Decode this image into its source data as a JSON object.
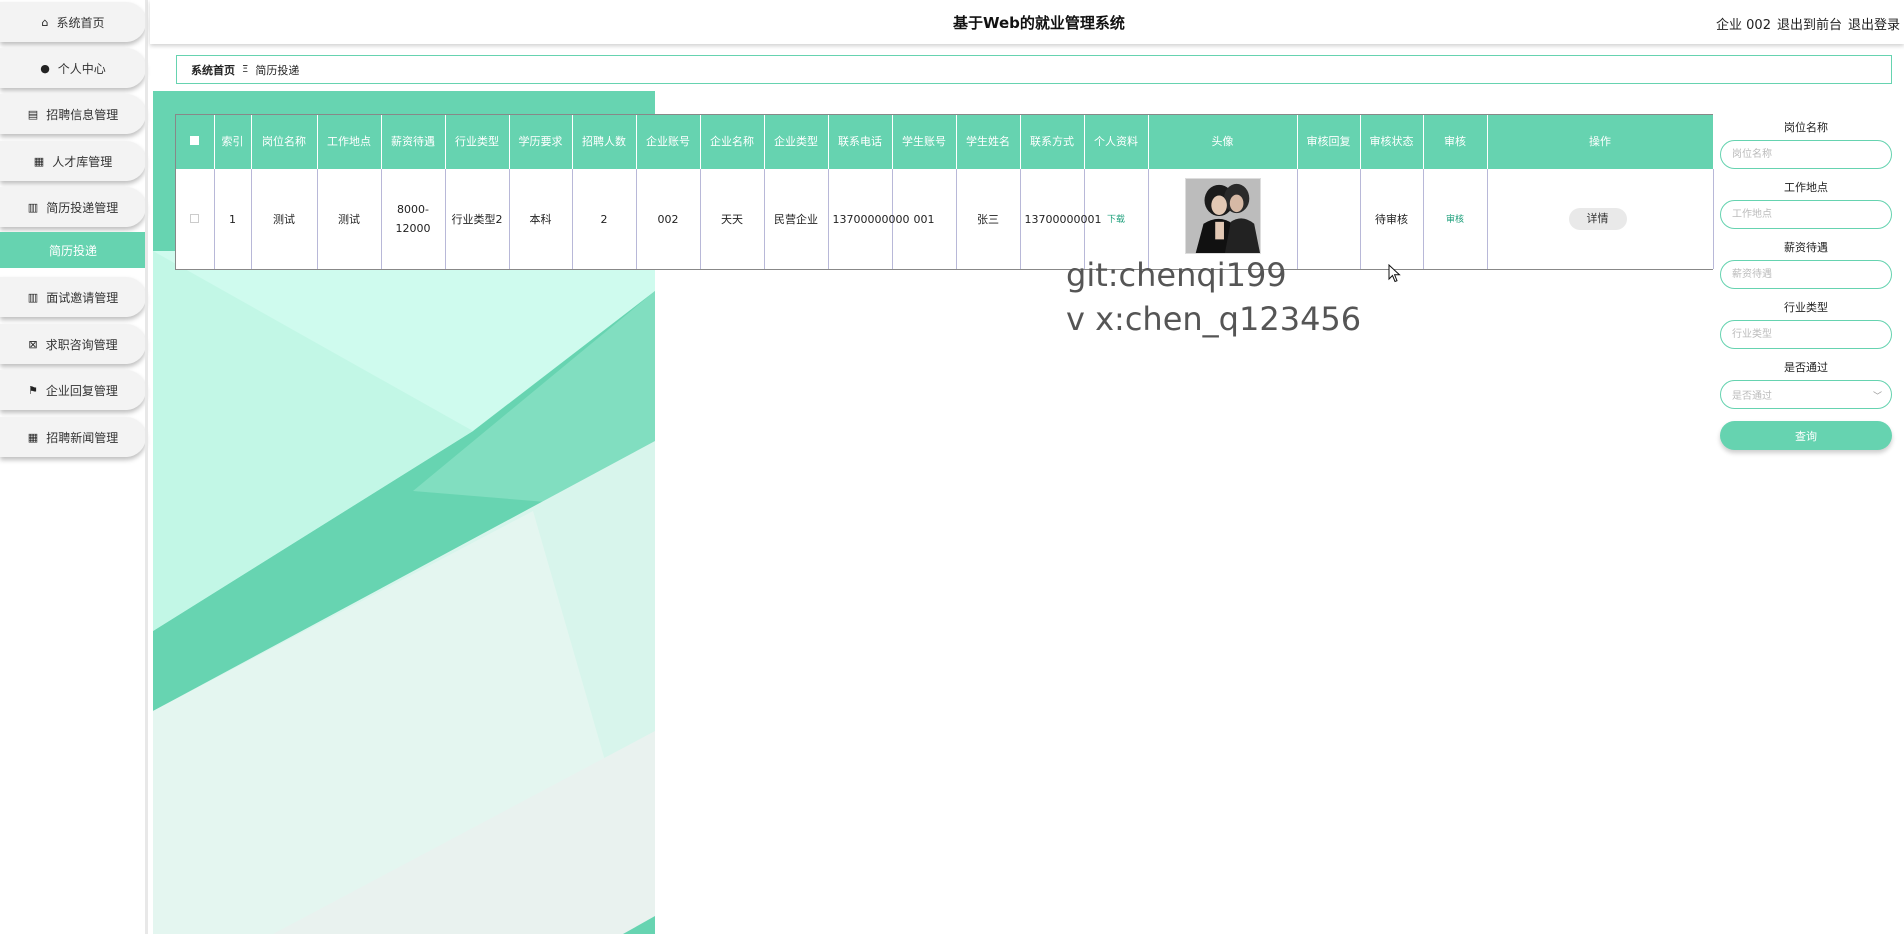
{
  "sidebar": {
    "items": [
      {
        "label": "系统首页",
        "icon": "home-icon"
      },
      {
        "label": "个人中心",
        "icon": "user-icon"
      },
      {
        "label": "招聘信息管理",
        "icon": "briefcase-icon"
      },
      {
        "label": "人才库管理",
        "icon": "grid-icon"
      },
      {
        "label": "简历投递管理",
        "icon": "clipboard-icon"
      },
      {
        "label": "面试邀请管理",
        "icon": "columns-icon"
      },
      {
        "label": "求职咨询管理",
        "icon": "box-x-icon"
      },
      {
        "label": "企业回复管理",
        "icon": "flag-icon"
      },
      {
        "label": "招聘新闻管理",
        "icon": "grid-icon"
      }
    ],
    "active_sub": "简历投递"
  },
  "header": {
    "title": "基于Web的就业管理系统",
    "user": "企业 002",
    "back_front": "退出到前台",
    "logout": "退出登录"
  },
  "breadcrumb": {
    "home": "系统首页",
    "separator": "Ξ",
    "current": "简历投递"
  },
  "table": {
    "columns": [
      "索引",
      "岗位名称",
      "工作地点",
      "薪资待遇",
      "行业类型",
      "学历要求",
      "招聘人数",
      "企业账号",
      "企业名称",
      "企业类型",
      "联系电话",
      "学生账号",
      "学生姓名",
      "联系方式",
      "个人资料",
      "头像",
      "审核回复",
      "审核状态",
      "审核",
      "操作"
    ],
    "rows": [
      {
        "index": "1",
        "job_name": "测试",
        "location": "测试",
        "salary": "8000-12000",
        "industry": "行业类型2",
        "education": "本科",
        "headcount": "2",
        "company_account": "002",
        "company_name": "天天",
        "company_type": "民营企业",
        "phone": "13700000000",
        "student_account": "001",
        "student_name": "张三",
        "contact": "13700000001",
        "resume_link": "下载",
        "review_reply": "",
        "review_status": "待审核",
        "review_action": "审核",
        "detail_button": "详情"
      }
    ]
  },
  "watermark": {
    "line1": "git:chenqi199",
    "line2": "v x:chen_q123456"
  },
  "search": {
    "job_name": {
      "label": "岗位名称",
      "placeholder": "岗位名称"
    },
    "location": {
      "label": "工作地点",
      "placeholder": "工作地点"
    },
    "salary": {
      "label": "薪资待遇",
      "placeholder": "薪资待遇"
    },
    "industry": {
      "label": "行业类型",
      "placeholder": "行业类型"
    },
    "passed": {
      "label": "是否通过",
      "placeholder": "是否通过"
    },
    "button": "查询"
  },
  "colors": {
    "accent": "#66d3b0",
    "link": "#1fa07c"
  }
}
